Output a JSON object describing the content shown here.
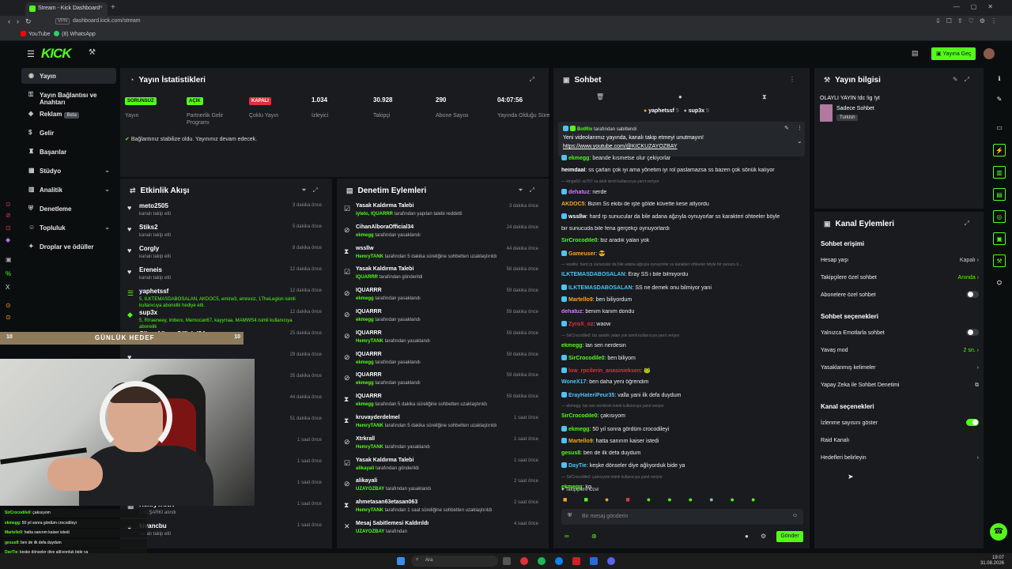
{
  "browser": {
    "tab_title": "Stream - Kick Dashboard",
    "url": "dashboard.kick.com/stream",
    "vpn": "VPN",
    "bookmarks": [
      "YouTube",
      "(8) WhatsApp"
    ]
  },
  "topbar": {
    "logo": "KICK",
    "go_live_label": "Yayına Geç"
  },
  "sidebar": {
    "items": [
      {
        "label": "Yayın"
      },
      {
        "label": "Yayın Bağlantısı ve Anahtarı"
      },
      {
        "label": "Reklam",
        "badge": "Beta"
      },
      {
        "label": "Gelir"
      },
      {
        "label": "Başarılar"
      },
      {
        "label": "Stüdyo"
      },
      {
        "label": "Analitik"
      },
      {
        "label": "Denetleme"
      },
      {
        "label": "Topluluk"
      },
      {
        "label": "Droplar ve ödüller"
      }
    ]
  },
  "stats": {
    "title": "Yayın İstatistikleri",
    "items": [
      {
        "value": "SORUNSUZ",
        "label": "Yayın",
        "color": "#53fc18"
      },
      {
        "value": "AÇIK",
        "label": "Partnerlik Gelir Programı",
        "color": "#53fc18"
      },
      {
        "value": "KAPALI",
        "label": "Çoklu Yayın",
        "color": "#e0303a"
      },
      {
        "value": "1.034",
        "label": "İzleyici"
      },
      {
        "value": "30.928",
        "label": "Takipçi"
      },
      {
        "value": "290",
        "label": "Abone Sayısı"
      },
      {
        "value": "04:07:56",
        "label": "Yayında Olduğu Süre"
      }
    ],
    "notice": "Bağlantınız stabilize oldu. Yayınınız devam edecek."
  },
  "activity": {
    "title": "Etkinlik Akışı",
    "rows": [
      {
        "name": "meto2505",
        "sub": "kanalı takip etti",
        "time": "3 dakika önce"
      },
      {
        "name": "Stiks2",
        "sub": "kanalı takip etti",
        "time": "5 dakika önce"
      },
      {
        "name": "Corgly",
        "sub": "kanalı takip etti",
        "time": "8 dakika önce"
      },
      {
        "name": "Ereneis",
        "sub": "kanalı takip etti",
        "time": "12 dakika önce"
      },
      {
        "name": "yaphetssf",
        "sub": "5, ILKTEMASDABOSALAN, AKDOC5, emirw3, emrexiz, 1TheLegion isimli kullanıcıya abonelik hediye etti.",
        "time": "12 dakika önce"
      },
      {
        "name": "sup3x",
        "sub": "5, Rrraeneey, imberx, Memocan67, kayyrraa, MAMWS4 isimli kullanıcıya abonelik",
        "time": "12 dakika önce"
      },
      {
        "name": "CihanAlboraOfficial34",
        "sub": "kanalı takip etti",
        "time": "25 dakika önce"
      },
      {
        "name": "",
        "sub": "",
        "time": "29 dakika önce"
      },
      {
        "name": "",
        "sub": "",
        "time": "35 dakika önce"
      },
      {
        "name": "",
        "sub": "",
        "time": "44 dakika önce"
      },
      {
        "name": "",
        "sub": "",
        "time": "51 dakika önce"
      },
      {
        "name": "",
        "sub": "",
        "time": "1 saat önce"
      },
      {
        "name": "",
        "sub": "",
        "time": "1 saat önce"
      },
      {
        "name": "",
        "sub": "",
        "time": "1 saat önce"
      },
      {
        "name": "HenryTANK",
        "sub": "10K ŞARKI alındı",
        "time": "1 saat önce"
      },
      {
        "name": "kivancbu",
        "sub": "kanalı takip etti",
        "time": "1 saat önce"
      }
    ]
  },
  "goal": {
    "left": "10",
    "label": "GÜNLÜK HEDEF",
    "right": "10"
  },
  "webcam_chat": [
    {
      "user": "SirCrocodile0",
      "msg": "çakısıyom"
    },
    {
      "user": "ekmegg",
      "msg": "50 yıl sonra gördüm crocodileyi"
    },
    {
      "user": "Martello9",
      "msg": "hatta sanırım kaiser istedi"
    },
    {
      "user": "gesus8",
      "msg": "ben de ilk defa duydum"
    },
    {
      "user": "DayTie",
      "msg": "keşke dönseler diye ağlıyorduk bide ya"
    },
    {
      "user": "ekmegg",
      "msg": "kg"
    }
  ],
  "moderation": {
    "title": "Denetim Eylemleri",
    "rows": [
      {
        "name": "Yasak Kaldırma Talebi",
        "sub_user": "iyleto, IQUARRR",
        "sub": "tarafından yapılan talebi reddetti",
        "time": "3 dakika önce"
      },
      {
        "name": "CihanAlboraOfficial34",
        "sub_user": "ekmegg",
        "sub": "tarafından yasaklandı",
        "time": "24 dakika önce"
      },
      {
        "name": "wssllw",
        "sub_user": "HemryTANK",
        "sub": "tarafından 5 dakika süreliğine sohbetten uzaklaştırıldı",
        "time": "44 dakika önce"
      },
      {
        "name": "Yasak Kaldırma Talebi",
        "sub_user": "IQUARRR",
        "sub": "tarafından gönderildi",
        "time": "58 dakika önce"
      },
      {
        "name": "IQUARRR",
        "sub_user": "ekmegg",
        "sub": "tarafından yasaklandı",
        "time": "59 dakika önce"
      },
      {
        "name": "IQUARRR",
        "sub_user": "ekmegg",
        "sub": "tarafından yasaklandı",
        "time": "59 dakika önce"
      },
      {
        "name": "IQUARRR",
        "sub_user": "HemryTANK",
        "sub": "tarafından yasaklandı",
        "time": "59 dakika önce"
      },
      {
        "name": "IQUARRR",
        "sub_user": "ekmegg",
        "sub": "tarafından yasaklandı",
        "time": "59 dakika önce"
      },
      {
        "name": "IQUARRR",
        "sub_user": "ekmegg",
        "sub": "tarafından yasaklandı",
        "time": "59 dakika önce"
      },
      {
        "name": "IQUARRR",
        "sub_user": "ekmegg",
        "sub": "tarafından 5 dakika süreliğine sohbetten uzaklaştırıldı",
        "time": "59 dakika önce"
      },
      {
        "name": "kruvayderdelmel",
        "sub_user": "HemryTANK",
        "sub": "tarafından 5 dakika süreliğine sohbetten uzaklaştırıldı",
        "time": "1 saat önce"
      },
      {
        "name": "Xtrkrall",
        "sub_user": "HemryTANK",
        "sub": "tarafından yasaklandı",
        "time": "1 saat önce"
      },
      {
        "name": "Yasak Kaldırma Talebi",
        "sub_user": "alikayali",
        "sub": "tarafından gönderildi",
        "time": "1 saat önce"
      },
      {
        "name": "alikayali",
        "sub_user": "UZAYOZBAY",
        "sub": "tarafından yasaklandı",
        "time": "2 saat önce"
      },
      {
        "name": "ahmetasan63etasan063",
        "sub_user": "HemryTANK",
        "sub": "tarafından 1 saat süreliğine sohbetten uzaklaştırıldı",
        "time": "2 saat önce"
      },
      {
        "name": "Mesaj Sabitlemesi Kaldırıldı",
        "sub_user": "UZAYOZBAY",
        "sub": "tarafından",
        "time": "4 saat önce"
      }
    ]
  },
  "chat": {
    "title": "Sohbet",
    "top_gifters": [
      {
        "name": "yaphetssf",
        "count": "5"
      },
      {
        "name": "sup3x",
        "count": "5"
      }
    ],
    "pinned": {
      "by_user": "BotRix",
      "by_text": "tarafından sabitlendi",
      "msg": "Yeni videolarımız yayında, kanalı takip etmeyi unutmayın!",
      "link": "https://www.youtube.com/@KICKUZAYOZBAY"
    },
    "messages": [
      {
        "user": "ekmegg",
        "color": "#53fc18",
        "msg": "beande kısmetse olur çekiyorlar"
      },
      {
        "user": "heimdaal",
        "color": "#ffffff",
        "msg": "ss çarları çok iyi ama yönetim iyi rol paslamazsa ss bazen çok sönük kalıyor"
      },
      {
        "sys": true,
        "msg": "— kings60: xs707 sa dedi isimli kullanıcıya yanıt veriyor"
      },
      {
        "user": "dehatuz",
        "color": "#d977ff",
        "msg": "nerde"
      },
      {
        "user": "AKDOC5",
        "color": "#f5a623",
        "msg": "Bizim Ss ekibi de işte gölde küvette kese atlyordu"
      },
      {
        "user": "wssllw",
        "color": "#ffffff",
        "msg": "hard rp sunucular da bile adana ağzıyla oynuyorlar ss karakteri ohteeler böyle"
      },
      {
        "user": "",
        "color": "#ffffff",
        "msg": "bir sunucuda bile fena gerçekçi oynuyorlardı"
      },
      {
        "user": "SirCrocodile0",
        "color": "#53fc18",
        "msg": "biz aradık yalan yok"
      },
      {
        "user": "Gameuser",
        "color": "#f5a623",
        "msg": "😎"
      },
      {
        "sys": true,
        "msg": "— wssllw: hard rp sunucular da bile adana ağzıyla oynuyorlar ss karakteri ohteeler böyle bir sunucu b..."
      },
      {
        "user": "ILKTEMASDABOSALAN",
        "color": "#4fc3f7",
        "msg": "Eray SS i bile bilmiyordu"
      },
      {
        "user": "ILKTEMASDABOSALAN",
        "color": "#4fc3f7",
        "msg": "SS ne demek onu bilmiyor yani"
      },
      {
        "user": "Martello9",
        "color": "#f5a623",
        "msg": "ben biliyordum"
      },
      {
        "user": "dehatuz",
        "color": "#d977ff",
        "msg": "benım kanım dondu"
      },
      {
        "user": "ZyroX_oz",
        "color": "#e0303a",
        "msg": "waow"
      },
      {
        "sys": true,
        "msg": "— SirCrocodile0: biz aradık yalan yok isimli kullanıcıya yanıt veriyor"
      },
      {
        "user": "ekmegg",
        "color": "#53fc18",
        "msg": "lan sen nerdesin"
      },
      {
        "user": "SirCrocodile0",
        "color": "#53fc18",
        "msg": "ben biliyom"
      },
      {
        "user": "low_rpcilerin_anasinieksen",
        "color": "#e0303a",
        "msg": "🐸"
      },
      {
        "user": "WoneX17",
        "color": "#4fc3f7",
        "msg": "ben daha yeni öğrendim"
      },
      {
        "user": "ErayHateriPeur35",
        "color": "#4fc3f7",
        "msg": "valla yani ilk defa duydum"
      },
      {
        "sys": true,
        "msg": "— ekmegg: lan sen nerdesin isimli kullanıcıya yanıt veriyor"
      },
      {
        "user": "SirCrocodile0",
        "color": "#53fc18",
        "msg": "çakısıyom"
      },
      {
        "user": "ekmegg",
        "color": "#53fc18",
        "msg": "50 yıl sonra gördüm crocodileyi"
      },
      {
        "user": "Martello9",
        "color": "#f5a623",
        "msg": "hatta sanırım kaiser istedi"
      },
      {
        "user": "gesus8",
        "color": "#53fc18",
        "msg": "ben de ilk defa duydum"
      },
      {
        "user": "DayTie",
        "color": "#4fc3f7",
        "msg": "keşke dönseler diye ağlıyorduk bide ya"
      },
      {
        "sys": true,
        "msg": "— SirCrocodile0: çakısıyom isimli kullanıcıya yanıt veriyor"
      },
      {
        "user": "ekmegg",
        "color": "#53fc18",
        "msg": "kg"
      }
    ],
    "followers_only": "Takipçilere Özel",
    "input_placeholder": "Bir mesaj gönderin",
    "send_label": "Gönder"
  },
  "stream_info": {
    "title": "Yayın bilgisi",
    "stream_title": "OLAYLI YAYIN !dc !ig !yt",
    "category": "Sadece Sohbet",
    "language": "Turkish"
  },
  "channel_actions": {
    "title": "Kanal Eylemleri",
    "sections": [
      {
        "heading": "Sohbet erişimi",
        "rows": [
          {
            "label": "Hesap yaşı",
            "value": "Kapalı",
            "type": "chevron"
          },
          {
            "label": "Takipçilere özel sohbet",
            "value": "Anında",
            "type": "chevron"
          },
          {
            "label": "Abonelere özel sohbet",
            "value": "",
            "type": "toggle-off"
          }
        ]
      },
      {
        "heading": "Sohbet seçenekleri",
        "rows": [
          {
            "label": "Yalnızca Emotlarla sohbet",
            "value": "",
            "type": "toggle-off"
          },
          {
            "label": "Yavaş mod",
            "value": "2 sn.",
            "type": "chevron"
          },
          {
            "label": "Yasaklanmış kelimeler",
            "value": "",
            "type": "chevron"
          },
          {
            "label": "Yapay Zeka ile Sohbet Denetimi",
            "value": "",
            "type": "external"
          }
        ]
      },
      {
        "heading": "Kanal seçenekleri",
        "rows": [
          {
            "label": "İzlenme sayısını göster",
            "value": "",
            "type": "toggle-on"
          },
          {
            "label": "Raid Kanalı",
            "value": "",
            "type": "none"
          },
          {
            "label": "Hedefleri belirleyin",
            "value": "",
            "type": "chevron"
          }
        ]
      }
    ]
  },
  "taskbar": {
    "search": "Ara",
    "time": "19:07",
    "date": "31.08.2026"
  }
}
